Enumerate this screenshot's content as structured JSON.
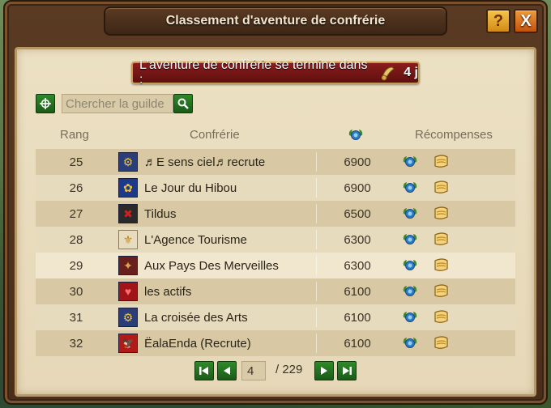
{
  "window": {
    "title": "Classement d'aventure de confrérie",
    "help_label": "?",
    "close_label": "X"
  },
  "banner": {
    "text": "L'aventure de confrérie se termine dans :",
    "time": "4 j"
  },
  "search": {
    "placeholder": "Chercher la guilde"
  },
  "table": {
    "headers": {
      "rank": "Rang",
      "guild": "Confrérie",
      "rewards": "Récompenses"
    },
    "rows": [
      {
        "rank": "25",
        "name": "♬E sens ciel♬recrute",
        "score": "6900",
        "emblem_color": "#2a3f7a",
        "emblem_glyph": "⚙"
      },
      {
        "rank": "26",
        "name": "Le Jour du Hibou",
        "score": "6900",
        "emblem_color": "#1c3a8a",
        "emblem_glyph": "✿"
      },
      {
        "rank": "27",
        "name": "Tildus",
        "score": "6500",
        "emblem_color": "#2a2a2a",
        "emblem_glyph": "✖"
      },
      {
        "rank": "28",
        "name": "L'Agence Tourisme",
        "score": "6300",
        "emblem_color": "#e8dcc0",
        "emblem_glyph": "⚜"
      },
      {
        "rank": "29",
        "name": "Aux Pays Des Merveilles",
        "score": "6300",
        "emblem_color": "#6a1f1f",
        "emblem_glyph": "✦"
      },
      {
        "rank": "30",
        "name": "les actifs",
        "score": "6100",
        "emblem_color": "#a0141a",
        "emblem_glyph": "♥"
      },
      {
        "rank": "31",
        "name": "La croisée des Arts",
        "score": "6100",
        "emblem_color": "#2a3f7a",
        "emblem_glyph": "⚙"
      },
      {
        "rank": "32",
        "name": "ËalaEnda (Recrute)",
        "score": "6100",
        "emblem_color": "#b21a1a",
        "emblem_glyph": "🦅"
      }
    ]
  },
  "pagination": {
    "current_page": "4",
    "total": "/ 229"
  },
  "colors": {
    "accent_red": "#7a1515",
    "button_green": "#2f8a2a",
    "parchment": "#e6d8b8"
  }
}
